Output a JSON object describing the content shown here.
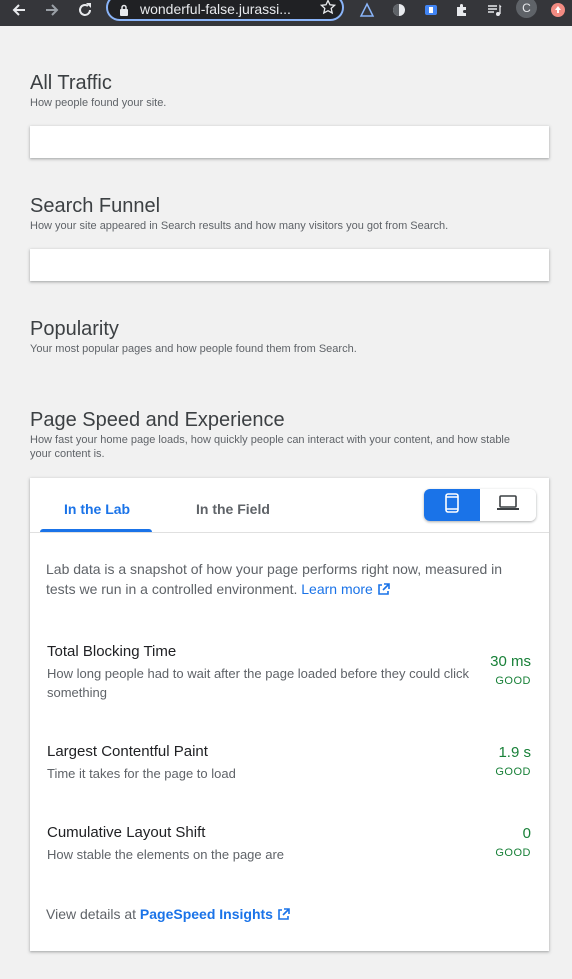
{
  "browser": {
    "url": "wonderful-false.jurassi...",
    "avatar_letter": "C"
  },
  "sections": {
    "all_traffic": {
      "title": "All Traffic",
      "subtitle": "How people found your site."
    },
    "search_funnel": {
      "title": "Search Funnel",
      "subtitle": "How your site appeared in Search results and how many visitors you got from Search."
    },
    "popularity": {
      "title": "Popularity",
      "subtitle": "Your most popular pages and how people found them from Search."
    },
    "page_speed": {
      "title": "Page Speed and Experience",
      "subtitle": "How fast your home page loads, how quickly people can interact with your content, and how stable your content is."
    }
  },
  "speed_card": {
    "tabs": [
      "In the Lab",
      "In the Field"
    ],
    "active_tab": "In the Lab",
    "device_selected": "mobile",
    "lab_description": "Lab data is a snapshot of how your page performs right now, measured in tests we run in a controlled environment.",
    "learn_more": "Learn more",
    "metrics": [
      {
        "name": "Total Blocking Time",
        "description": "How long people had to wait after the page loaded before they could click something",
        "value": "30 ms",
        "rating": "GOOD"
      },
      {
        "name": "Largest Contentful Paint",
        "description": "Time it takes for the page to load",
        "value": "1.9 s",
        "rating": "GOOD"
      },
      {
        "name": "Cumulative Layout Shift",
        "description": "How stable the elements on the page are",
        "value": "0",
        "rating": "GOOD"
      }
    ],
    "details_prefix": "View details at",
    "details_link": "PageSpeed Insights"
  },
  "colors": {
    "accent": "#1a73e8",
    "good": "#188038",
    "background": "#f1f1f1"
  }
}
